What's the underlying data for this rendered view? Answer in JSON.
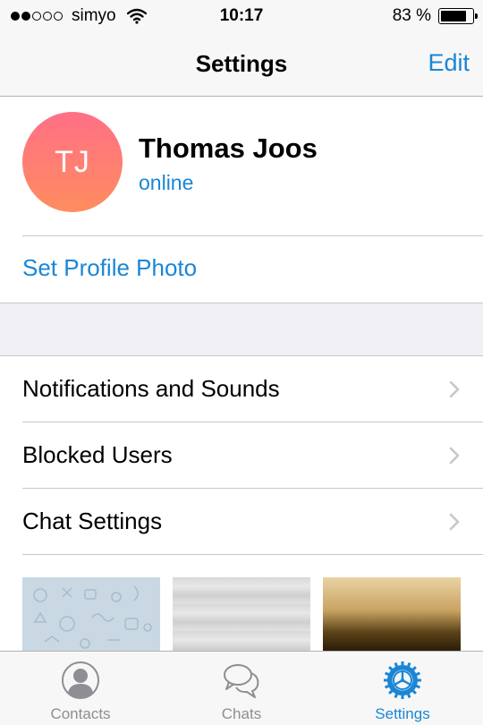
{
  "status_bar": {
    "signal_filled": 2,
    "signal_total": 5,
    "carrier": "simyo",
    "time": "10:17",
    "battery_percent": "83 %",
    "battery_level": 0.83
  },
  "nav": {
    "title": "Settings",
    "edit_label": "Edit"
  },
  "profile": {
    "initials": "TJ",
    "name": "Thomas Joos",
    "status": "online",
    "set_photo_label": "Set Profile Photo"
  },
  "settings_items": [
    {
      "label": "Notifications and Sounds"
    },
    {
      "label": "Blocked Users"
    },
    {
      "label": "Chat Settings"
    }
  ],
  "tabs": [
    {
      "label": "Contacts",
      "icon": "contacts-icon",
      "active": false
    },
    {
      "label": "Chats",
      "icon": "chats-icon",
      "active": false
    },
    {
      "label": "Settings",
      "icon": "settings-gear-icon",
      "active": true
    }
  ],
  "colors": {
    "accent": "#1a86d6",
    "inactive": "#8e8e93",
    "avatar_top": "#ff6f86",
    "avatar_bottom": "#ff8d5f"
  }
}
